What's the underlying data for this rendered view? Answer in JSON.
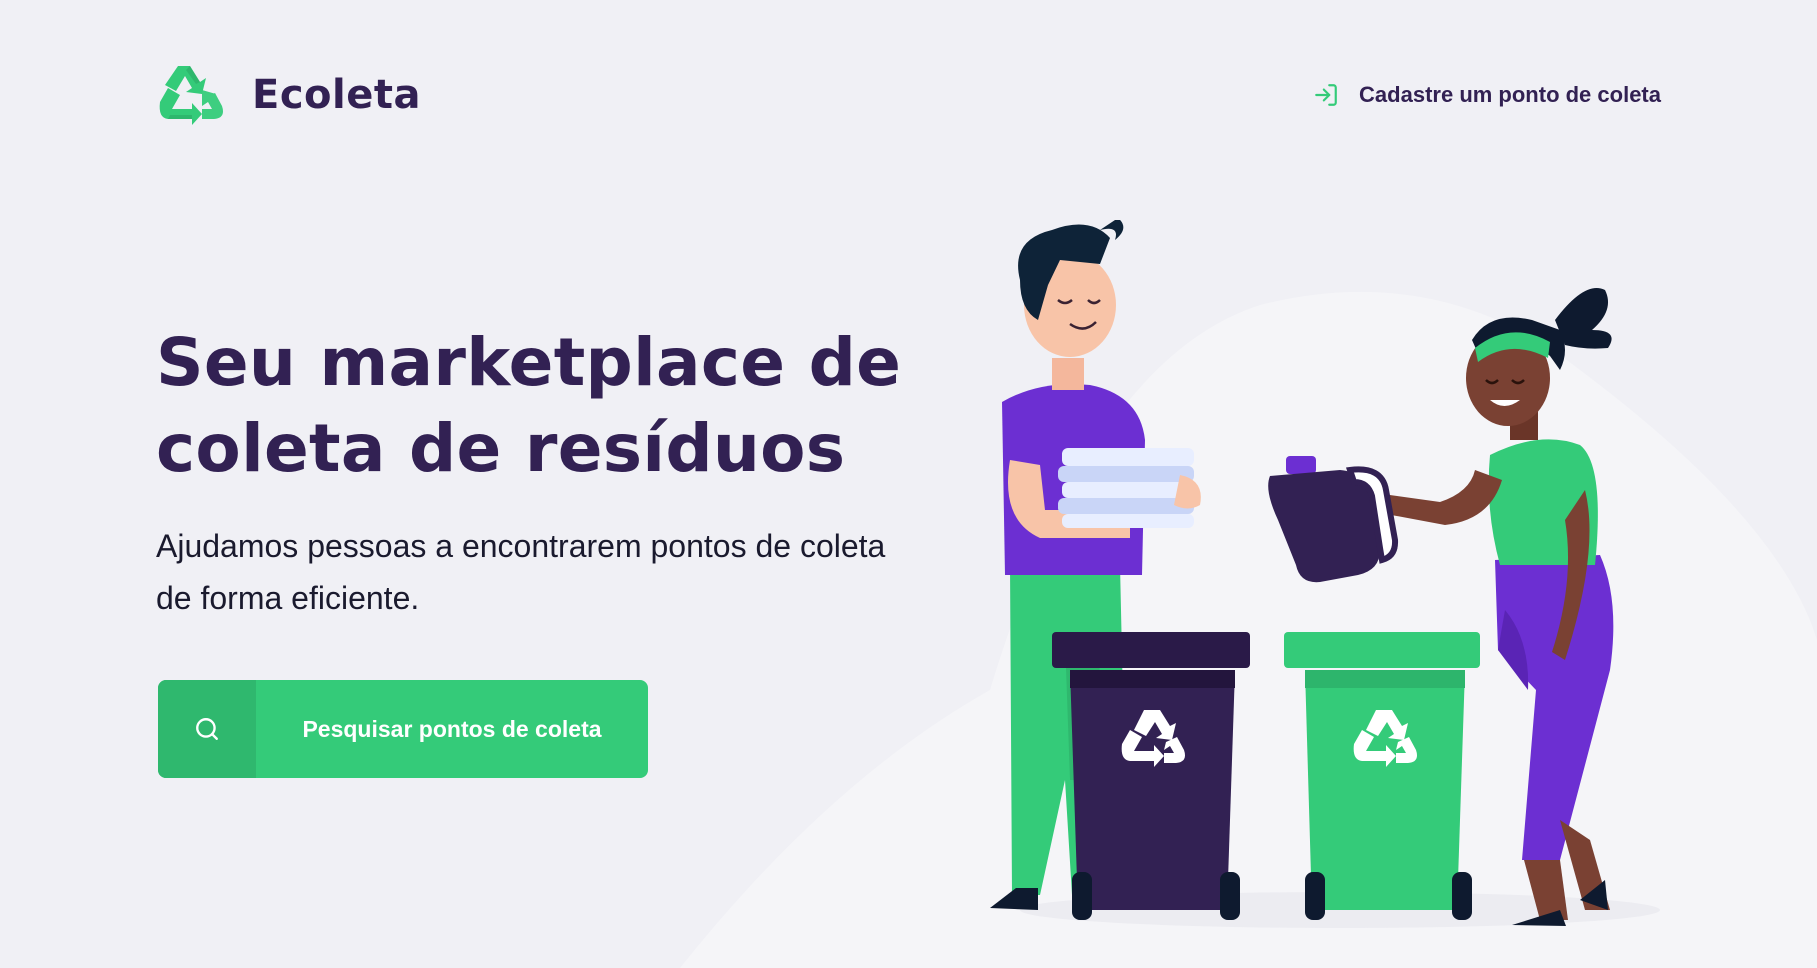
{
  "header": {
    "app_name": "Ecoleta",
    "logo_icon": "recycle-icon",
    "register_link": {
      "label": "Cadastre um ponto de coleta",
      "icon": "log-in-icon"
    }
  },
  "hero": {
    "title_line1": "Seu marketplace de",
    "title_line2": "coleta de resíduos",
    "subtitle_line1": "Ajudamos pessoas a encontrarem pontos de coleta",
    "subtitle_line2": "de forma eficiente."
  },
  "search_button": {
    "label": "Pesquisar pontos de coleta",
    "icon": "search-icon"
  },
  "illustration": {
    "description_icon": "recycling-people-illustration"
  },
  "colors": {
    "background": "#F0F0F5",
    "primary": "#34CB79",
    "primary_dark": "#2FB86E",
    "title": "#322153",
    "purple": "#6C2FD2"
  }
}
